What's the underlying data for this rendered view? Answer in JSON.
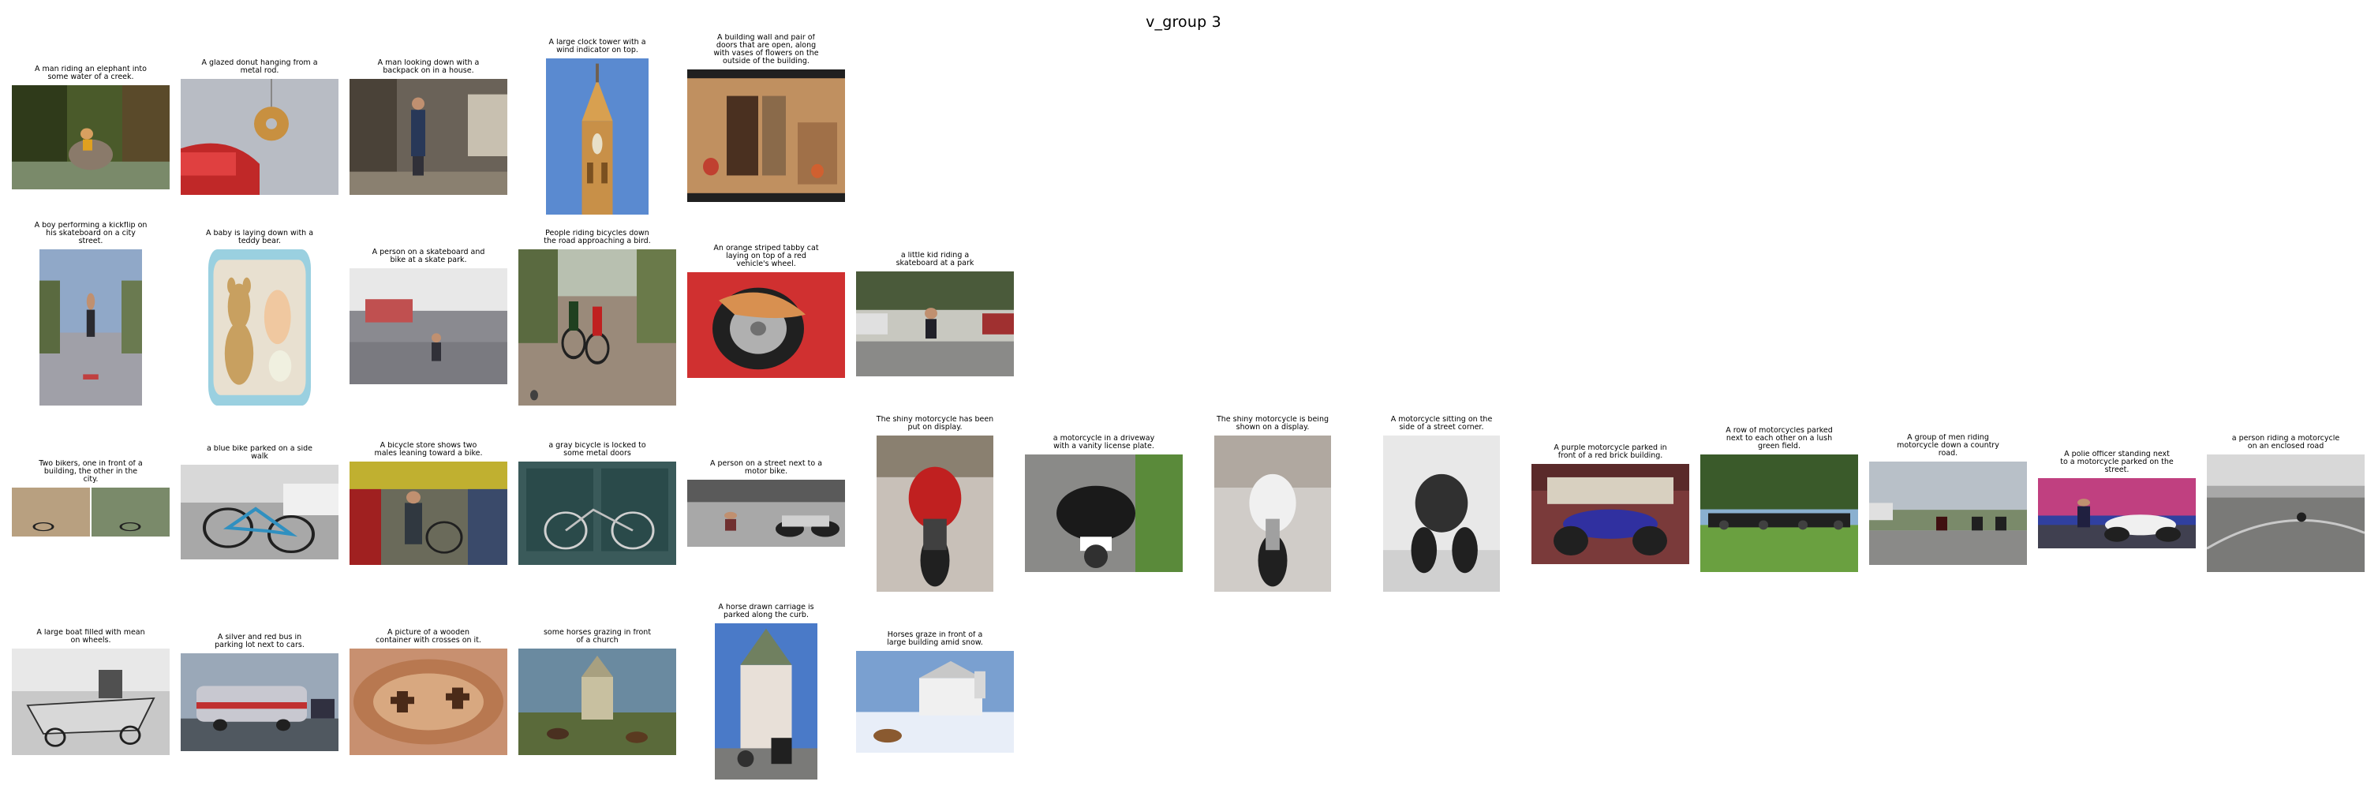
{
  "title": "v_group 3",
  "items": [
    {
      "caption": "A man riding an elephant into\nsome water of a creek.",
      "scene": "elephant_creek"
    },
    {
      "caption": "A glazed donut hanging from a\nmetal rod.",
      "scene": "donut_car"
    },
    {
      "caption": "A man looking down with a\nbackpack on in a house.",
      "scene": "man_backpack"
    },
    {
      "caption": "A large clock tower with a\nwind indicator on top.",
      "scene": "clock_tower"
    },
    {
      "caption": "A building wall and pair of\ndoors that are open, along\nwith vases of flowers on the\noutside of the building.",
      "scene": "building_doors"
    },
    {
      "caption": "A boy performing a kickflip on\nhis skateboard on a city\nstreet.",
      "scene": "kickflip"
    },
    {
      "caption": "A baby is laying down with a\nteddy bear.",
      "scene": "baby_bear"
    },
    {
      "caption": "A person on a skateboard and\nbike at a skate park.",
      "scene": "skatepark"
    },
    {
      "caption": "People riding bicycles down\nthe road approaching a bird.",
      "scene": "cyclists"
    },
    {
      "caption": "An orange striped tabby cat\nlaying on top of a red\nvehicle's wheel.",
      "scene": "cat_wheel"
    },
    {
      "caption": "a little kid riding a\nskateboard at a park",
      "scene": "kid_skate"
    },
    {
      "caption": "Two bikers, one in front of a\nbuilding, the other in the\ncity.",
      "scene": "two_bikers"
    },
    {
      "caption": "a blue bike parked on a side\nwalk",
      "scene": "blue_bike"
    },
    {
      "caption": "A bicycle store shows two\nmales leaning toward a bike.",
      "scene": "bike_store"
    },
    {
      "caption": "a gray bicycle is locked to\nsome metal doors",
      "scene": "gray_bicycle"
    },
    {
      "caption": "A person on a street next to a\nmotor bike.",
      "scene": "street_motorbike"
    },
    {
      "caption": "The shiny motorcycle has been\nput on display.",
      "scene": "moto_display_red"
    },
    {
      "caption": "a motorcycle in a driveway\nwith a vanity license plate.",
      "scene": "moto_driveway"
    },
    {
      "caption": "The shiny motorcycle is being\nshown on a display.",
      "scene": "moto_display_white"
    },
    {
      "caption": "A motorcycle sitting on the\nside of a street corner.",
      "scene": "moto_corner"
    },
    {
      "caption": "A purple motorcycle parked in\nfront of a red brick building.",
      "scene": "purple_moto"
    },
    {
      "caption": "A row of motorcycles parked\nnext to each other on a lush\ngreen field.",
      "scene": "moto_row"
    },
    {
      "caption": "A group of men riding\nmotorcycle down a country\nroad.",
      "scene": "country_road"
    },
    {
      "caption": "A polie officer standing next\nto a  motorcycle parked on the\nstreet.",
      "scene": "police_moto"
    },
    {
      "caption": "a person riding a motorcycle\non an enclosed road",
      "scene": "enclosed_road"
    },
    {
      "caption": "A large boat filled with mean\non wheels.",
      "scene": "boat_wheels"
    },
    {
      "caption": "A silver and red bus in\nparking lot next to cars.",
      "scene": "bus"
    },
    {
      "caption": "A picture of a wooden\ncontainer with crosses on it.",
      "scene": "wooden_container"
    },
    {
      "caption": "some horses grazing in front\nof a church",
      "scene": "horses_church"
    },
    {
      "caption": "A horse drawn carriage is\nparked along the curb.",
      "scene": "horse_carriage"
    },
    {
      "caption": "Horses graze in front of a\nlarge building amid snow.",
      "scene": "horses_snow"
    }
  ]
}
